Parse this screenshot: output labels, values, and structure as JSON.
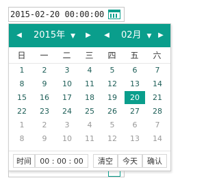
{
  "input": {
    "value": "2015-02-20 00:00:00"
  },
  "header": {
    "year_label": "2015年",
    "month_label": "02月",
    "prev_year_icon": "◀",
    "next_year_icon": "▶",
    "prev_month_icon": "◀",
    "next_month_icon": "▶",
    "dropdown_icon": "▼"
  },
  "weekdays": [
    "日",
    "一",
    "二",
    "三",
    "四",
    "五",
    "六"
  ],
  "days": [
    [
      "1",
      "2",
      "3",
      "4",
      "5",
      "6",
      "7"
    ],
    [
      "8",
      "9",
      "10",
      "11",
      "12",
      "13",
      "14"
    ],
    [
      "15",
      "16",
      "17",
      "18",
      "19",
      "20",
      "21"
    ],
    [
      "22",
      "23",
      "24",
      "25",
      "26",
      "27",
      "28"
    ],
    [
      "1",
      "2",
      "3",
      "4",
      "5",
      "6",
      "7"
    ],
    [
      "8",
      "9",
      "10",
      "11",
      "12",
      "13",
      "14"
    ]
  ],
  "selected_day": "20",
  "footer": {
    "time_label": "时间",
    "time_value": "00 : 00 : 00",
    "clear_label": "清空",
    "today_label": "今天",
    "confirm_label": "确认"
  },
  "colors": {
    "accent": "#0a9e8c",
    "other_month": "#999999",
    "day_text": "#1d5e57"
  }
}
